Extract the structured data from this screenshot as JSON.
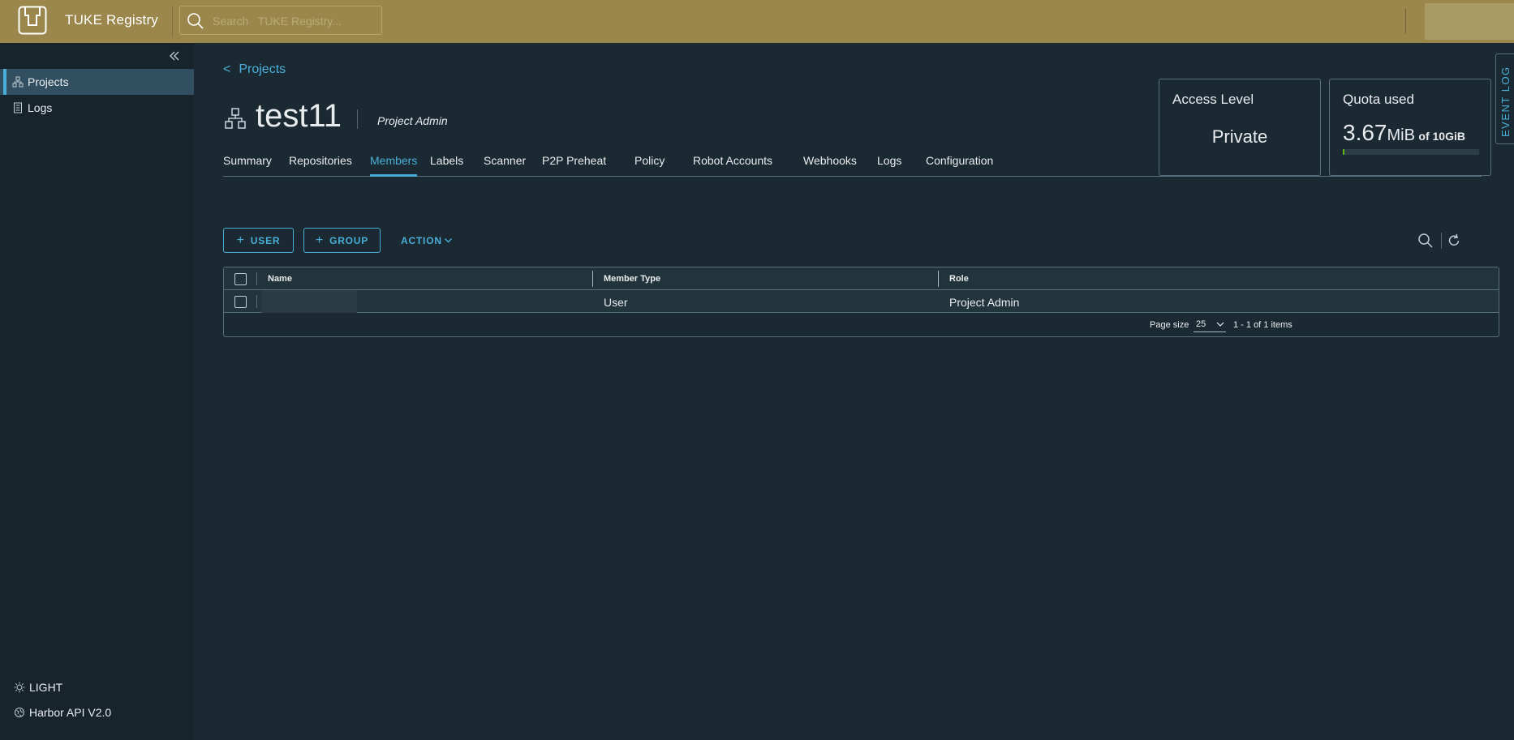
{
  "header": {
    "brand": "TUKE Registry",
    "search_placeholder": "Search   TUKE Registry..."
  },
  "sidebar": {
    "items": [
      {
        "label": "Projects",
        "icon": "projects-icon",
        "active": true
      },
      {
        "label": "Logs",
        "icon": "logs-icon",
        "active": false
      }
    ],
    "theme_toggle": "LIGHT",
    "api_link": "Harbor API V2.0"
  },
  "breadcrumb": {
    "label": "Projects"
  },
  "project": {
    "name": "test11",
    "role": "Project Admin"
  },
  "access_card": {
    "title": "Access Level",
    "value": "Private"
  },
  "quota_card": {
    "title": "Quota used",
    "used_number": "3.67",
    "used_unit": "MiB",
    "of_text": "of 10GiB",
    "fill_fraction": 0.0004,
    "bar_color": "#60b515"
  },
  "event_log": "EVENT LOG",
  "tabs": [
    {
      "label": "Summary",
      "active": false
    },
    {
      "label": "Repositories",
      "active": false
    },
    {
      "label": "Members",
      "active": true
    },
    {
      "label": "Labels",
      "active": false
    },
    {
      "label": "Scanner",
      "active": false
    },
    {
      "label": "P2P Preheat",
      "active": false
    },
    {
      "label": "Policy",
      "active": false
    },
    {
      "label": "Robot Accounts",
      "active": false
    },
    {
      "label": "Webhooks",
      "active": false
    },
    {
      "label": "Logs",
      "active": false
    },
    {
      "label": "Configuration",
      "active": false
    }
  ],
  "toolbar": {
    "add_user": "USER",
    "add_group": "GROUP",
    "action": "ACTION"
  },
  "table": {
    "columns": [
      "Name",
      "Member Type",
      "Role"
    ],
    "rows": [
      {
        "name": "",
        "member_type": "User",
        "role": "Project Admin"
      }
    ],
    "page_size_label": "Page size",
    "page_size": "25",
    "range": "1 - 1 of 1 items"
  },
  "colors": {
    "header_bg": "#9b874b",
    "accent": "#49afd9",
    "page_bg": "#1b2a32",
    "sidebar_bg": "#17242b"
  }
}
